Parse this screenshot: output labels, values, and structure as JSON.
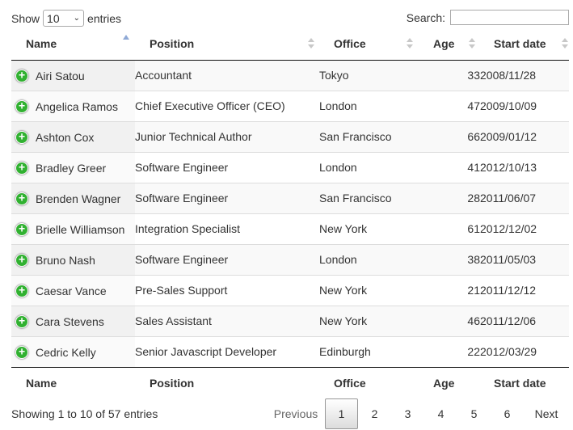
{
  "length_menu": {
    "show_label": "Show",
    "value": "10",
    "entries_label": "entries"
  },
  "search": {
    "label": "Search:",
    "value": ""
  },
  "columns": [
    "Name",
    "Position",
    "Office",
    "Age",
    "Start date"
  ],
  "rows": [
    [
      "Airi Satou",
      "Accountant",
      "Tokyo",
      "33",
      "2008/11/28"
    ],
    [
      "Angelica Ramos",
      "Chief Executive Officer (CEO)",
      "London",
      "47",
      "2009/10/09"
    ],
    [
      "Ashton Cox",
      "Junior Technical Author",
      "San Francisco",
      "66",
      "2009/01/12"
    ],
    [
      "Bradley Greer",
      "Software Engineer",
      "London",
      "41",
      "2012/10/13"
    ],
    [
      "Brenden Wagner",
      "Software Engineer",
      "San Francisco",
      "28",
      "2011/06/07"
    ],
    [
      "Brielle Williamson",
      "Integration Specialist",
      "New York",
      "61",
      "2012/12/02"
    ],
    [
      "Bruno Nash",
      "Software Engineer",
      "London",
      "38",
      "2011/05/03"
    ],
    [
      "Caesar Vance",
      "Pre-Sales Support",
      "New York",
      "21",
      "2011/12/12"
    ],
    [
      "Cara Stevens",
      "Sales Assistant",
      "New York",
      "46",
      "2011/12/06"
    ],
    [
      "Cedric Kelly",
      "Senior Javascript Developer",
      "Edinburgh",
      "22",
      "2012/03/29"
    ]
  ],
  "expand_icon": "plus-circle-icon",
  "expand_glyph": "+",
  "sort": {
    "column": "Name",
    "direction": "ascending"
  },
  "info": "Showing 1 to 10 of 57 entries",
  "pagination": {
    "previous": "Previous",
    "pages": [
      "1",
      "2",
      "3",
      "4",
      "5",
      "6"
    ],
    "current": "1",
    "next": "Next"
  },
  "colors": {
    "expand_icon": "#31b131",
    "sort_active": "#8fa9d6",
    "header_border": "#111111"
  }
}
